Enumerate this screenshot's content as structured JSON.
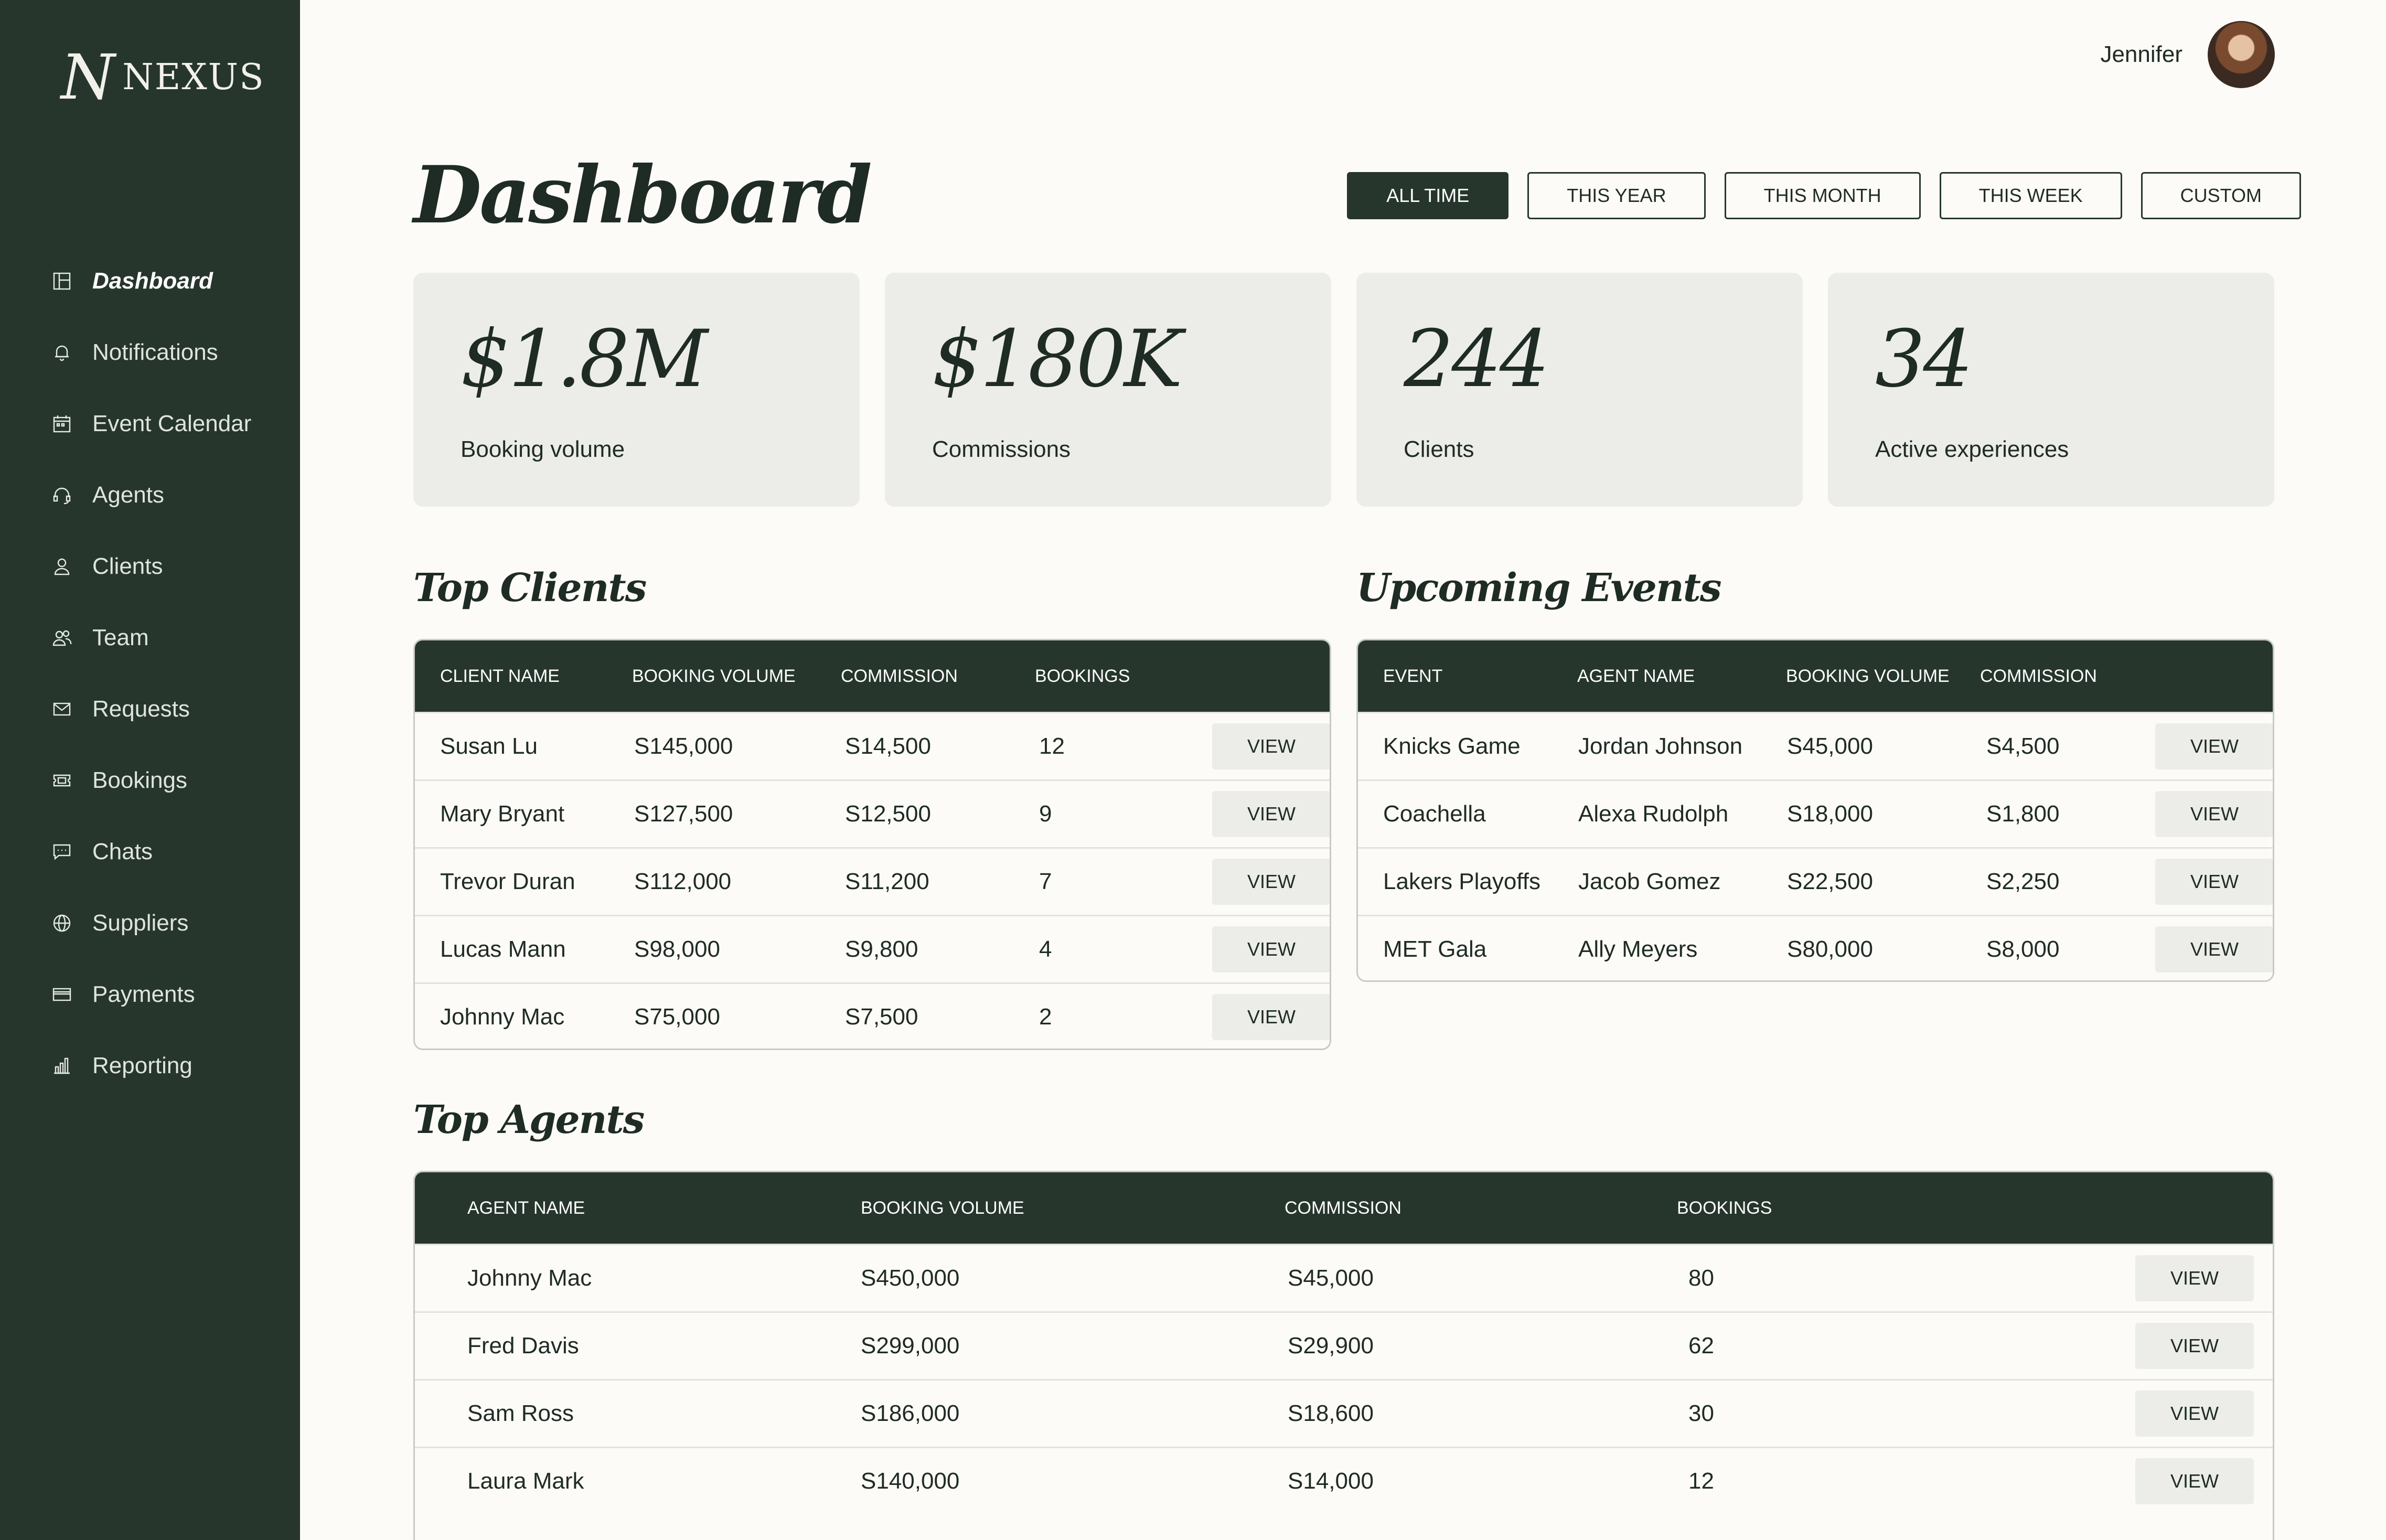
{
  "brand": {
    "mark": "N",
    "name": "NEXUS"
  },
  "sidebar": {
    "items": [
      {
        "label": "Dashboard",
        "icon": "layout-icon"
      },
      {
        "label": "Notifications",
        "icon": "bell-icon"
      },
      {
        "label": "Event Calendar",
        "icon": "calendar-icon"
      },
      {
        "label": "Agents",
        "icon": "headset-icon"
      },
      {
        "label": "Clients",
        "icon": "user-icon"
      },
      {
        "label": "Team",
        "icon": "users-icon"
      },
      {
        "label": "Requests",
        "icon": "mail-icon"
      },
      {
        "label": "Bookings",
        "icon": "ticket-icon"
      },
      {
        "label": "Chats",
        "icon": "chat-icon"
      },
      {
        "label": "Suppliers",
        "icon": "globe-icon"
      },
      {
        "label": "Payments",
        "icon": "card-icon"
      },
      {
        "label": "Reporting",
        "icon": "bar-chart-icon"
      }
    ]
  },
  "header": {
    "user_name": "Jennifer",
    "title": "Dashboard"
  },
  "filters": [
    "ALL TIME",
    "THIS YEAR",
    "THIS MONTH",
    "THIS WEEK",
    "CUSTOM"
  ],
  "kpis": [
    {
      "value": "$1.8M",
      "label": "Booking volume"
    },
    {
      "value": "$180K",
      "label": "Commissions"
    },
    {
      "value": "244",
      "label": "Clients"
    },
    {
      "value": "34",
      "label": "Active experiences"
    }
  ],
  "top_clients": {
    "title": "Top Clients",
    "columns": [
      "CLIENT NAME",
      "BOOKING VOLUME",
      "COMMISSION",
      "BOOKINGS"
    ],
    "view_label": "VIEW",
    "rows": [
      [
        "Susan Lu",
        "S145,000",
        "S14,500",
        "12"
      ],
      [
        "Mary Bryant",
        "S127,500",
        "S12,500",
        "9"
      ],
      [
        "Trevor Duran",
        "S112,000",
        "S11,200",
        "7"
      ],
      [
        "Lucas Mann",
        "S98,000",
        "S9,800",
        "4"
      ],
      [
        "Johnny Mac",
        "S75,000",
        "S7,500",
        "2"
      ]
    ]
  },
  "upcoming_events": {
    "title": "Upcoming Events",
    "columns": [
      "EVENT",
      "AGENT NAME",
      "BOOKING VOLUME",
      "COMMISSION"
    ],
    "view_label": "VIEW",
    "rows": [
      [
        "Knicks Game",
        "Jordan Johnson",
        "S45,000",
        "S4,500"
      ],
      [
        "Coachella",
        "Alexa Rudolph",
        "S18,000",
        "S1,800"
      ],
      [
        "Lakers Playoffs",
        "Jacob Gomez",
        "S22,500",
        "S2,250"
      ],
      [
        "MET Gala",
        "Ally Meyers",
        "S80,000",
        "S8,000"
      ]
    ]
  },
  "top_agents": {
    "title": "Top Agents",
    "columns": [
      "AGENT NAME",
      "BOOKING VOLUME",
      "COMMISSION",
      "BOOKINGS"
    ],
    "view_label": "VIEW",
    "rows": [
      [
        "Johnny Mac",
        "S450,000",
        "S45,000",
        "80"
      ],
      [
        "Fred Davis",
        "S299,000",
        "S29,900",
        "62"
      ],
      [
        "Sam Ross",
        "S186,000",
        "S18,600",
        "30"
      ],
      [
        "Laura Mark",
        "S140,000",
        "S14,000",
        "12"
      ]
    ]
  },
  "colors": {
    "sidebar": "#26362d",
    "page": "#fcfbf7",
    "card": "#ecede8",
    "text": "#1f2b25"
  }
}
